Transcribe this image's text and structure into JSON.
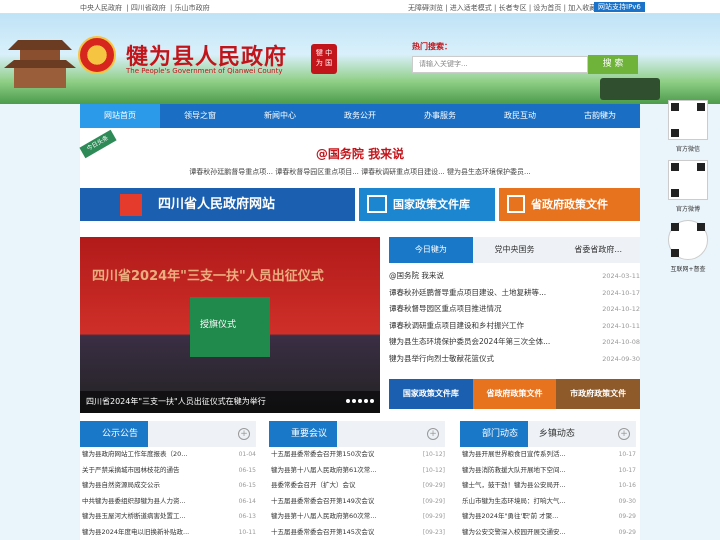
{
  "topbar": {
    "links": [
      "中央人民政府",
      "四川省政府",
      "乐山市政府"
    ],
    "right": "无障碍浏览 | 进入适老模式 | 长者专区 | 设为首页 | 加入收藏",
    "ipv6": "网站支持IPv6"
  },
  "header": {
    "title": "犍为县人民政府",
    "subtitle": "The People's Government of Qianwei County",
    "seal": "犍为中国",
    "hot_label": "热门搜索：",
    "search_placeholder": "请输入关键字...",
    "search_button": "搜 索"
  },
  "nav": [
    "网站首页",
    "领导之窗",
    "新闻中心",
    "政务公开",
    "办事服务",
    "政民互动",
    "古韵犍为"
  ],
  "headline": {
    "ribbon": "今日头条",
    "title": "@国务院 我来说",
    "sub": "谭春秋孙廷鹏督导重点项... 谭春秋督导园区重点项目... 谭春秋调研重点项目建设... 犍为县生态环境保护委员..."
  },
  "banners": {
    "b1": "四川省人民政府网站",
    "b2": "国家政策文件库",
    "b3": "省政府政策文件"
  },
  "photo": {
    "overlay": "四川省2024年\"三支一扶\"人员出征仪式",
    "stage": "授旗仪式",
    "caption": "四川省2024年\"三支一扶\"人员出征仪式在犍为举行"
  },
  "news": {
    "tabs": [
      "今日犍为",
      "党中央国务",
      "省委省政府..."
    ],
    "items": [
      {
        "title": "@国务院 我来说",
        "date": "2024-03-11"
      },
      {
        "title": "谭春秋孙廷鹏督导重点项目建设、土地复耕等...",
        "date": "2024-10-17"
      },
      {
        "title": "谭春秋督导园区重点项目推进情况",
        "date": "2024-10-12"
      },
      {
        "title": "谭春秋调研重点项目建设和乡村振兴工作",
        "date": "2024-10-11"
      },
      {
        "title": "犍为县生态环境保护委员会2024年第三次全体...",
        "date": "2024-10-08"
      },
      {
        "title": "犍为县举行向烈士敬献花篮仪式",
        "date": "2024-09-30"
      }
    ]
  },
  "policy": [
    "国家政策文件库",
    "省政府政策文件",
    "市政府政策文件"
  ],
  "columns": {
    "c1": {
      "title": "公示公告",
      "items": [
        {
          "t": "犍为县政府网站工作年度报表（20...",
          "d": "01-04"
        },
        {
          "t": "关于严禁采摘城市园林枝花的通告",
          "d": "06-15"
        },
        {
          "t": "犍为县自然资源局成交公示",
          "d": "06-15"
        },
        {
          "t": "中共犍为县委组织部犍为县人力资...",
          "d": "06-14"
        },
        {
          "t": "犍为县玉屋河大桥断道病害处置工...",
          "d": "06-13"
        },
        {
          "t": "犍为县2024年度电以旧换新补贴政...",
          "d": "10-11"
        }
      ]
    },
    "c2": {
      "title": "重要会议",
      "items": [
        {
          "t": "十五届县委常委会召开第150次会议",
          "d": "[10-12]"
        },
        {
          "t": "犍为县第十八届人民政府第61次常...",
          "d": "[10-12]"
        },
        {
          "t": "县委常委会召开（扩大）会议",
          "d": "[09-29]"
        },
        {
          "t": "十五届县委常委会召开第149次会议",
          "d": "[09-29]"
        },
        {
          "t": "犍为县第十八届人民政府第60次常...",
          "d": "[09-29]"
        },
        {
          "t": "十五届县委常委会召开第145次会议",
          "d": "[09-23]"
        }
      ]
    },
    "c3": {
      "title": "部门动态",
      "title2": "乡镇动态",
      "items": [
        {
          "t": "犍为县开展世界粮食日宣传系列活...",
          "d": "10-17"
        },
        {
          "t": "犍为县消防救援大队开展地下空间...",
          "d": "10-17"
        },
        {
          "t": "犍士气，鼓干劲！犍为县公安局开...",
          "d": "10-16"
        },
        {
          "t": "乐山市犍为生态环境局：打响大气...",
          "d": "09-30"
        },
        {
          "t": "犍为县2024年\"勇往'职'前 才聚...",
          "d": "09-29"
        },
        {
          "t": "犍为公安交警深入校园开展交通安...",
          "d": "09-29"
        }
      ]
    }
  },
  "qrcodes": [
    "官方微信",
    "官方微博",
    "互联网+督查"
  ],
  "colors": {
    "nav": "#1a6fc4",
    "red": "#c2151b",
    "orange": "#e8731e",
    "green": "#6fb33a"
  }
}
